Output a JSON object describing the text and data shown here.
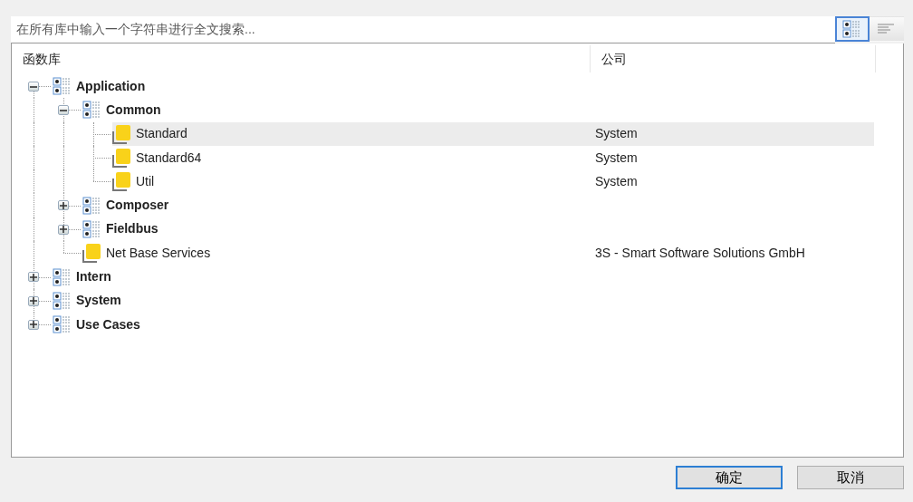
{
  "search": {
    "placeholder": "在所有库中输入一个字符串进行全文搜索..."
  },
  "view_buttons": [
    {
      "kind": "tree",
      "selected": true
    },
    {
      "kind": "list",
      "selected": false
    }
  ],
  "columns": [
    "函数库",
    "公司"
  ],
  "tree": [
    {
      "kind": "category",
      "label": "Application",
      "expanded": true,
      "selected": false,
      "children": [
        {
          "kind": "category",
          "label": "Common",
          "expanded": true,
          "selected": false,
          "children": [
            {
              "kind": "library",
              "label": "Standard",
              "company": "System",
              "selected": true
            },
            {
              "kind": "library",
              "label": "Standard64",
              "company": "System",
              "selected": false
            },
            {
              "kind": "library",
              "label": "Util",
              "company": "System",
              "selected": false
            }
          ]
        },
        {
          "kind": "category",
          "label": "Composer",
          "expanded": false,
          "selected": false
        },
        {
          "kind": "category",
          "label": "Fieldbus",
          "expanded": false,
          "selected": false
        },
        {
          "kind": "library",
          "label": "Net Base Services",
          "company": "3S - Smart Software Solutions GmbH",
          "selected": false
        }
      ]
    },
    {
      "kind": "category",
      "label": "Intern",
      "expanded": false,
      "selected": false
    },
    {
      "kind": "category",
      "label": "System",
      "expanded": false,
      "selected": false
    },
    {
      "kind": "category",
      "label": "Use Cases",
      "expanded": false,
      "selected": false
    }
  ],
  "buttons": [
    "确定",
    "取消"
  ]
}
